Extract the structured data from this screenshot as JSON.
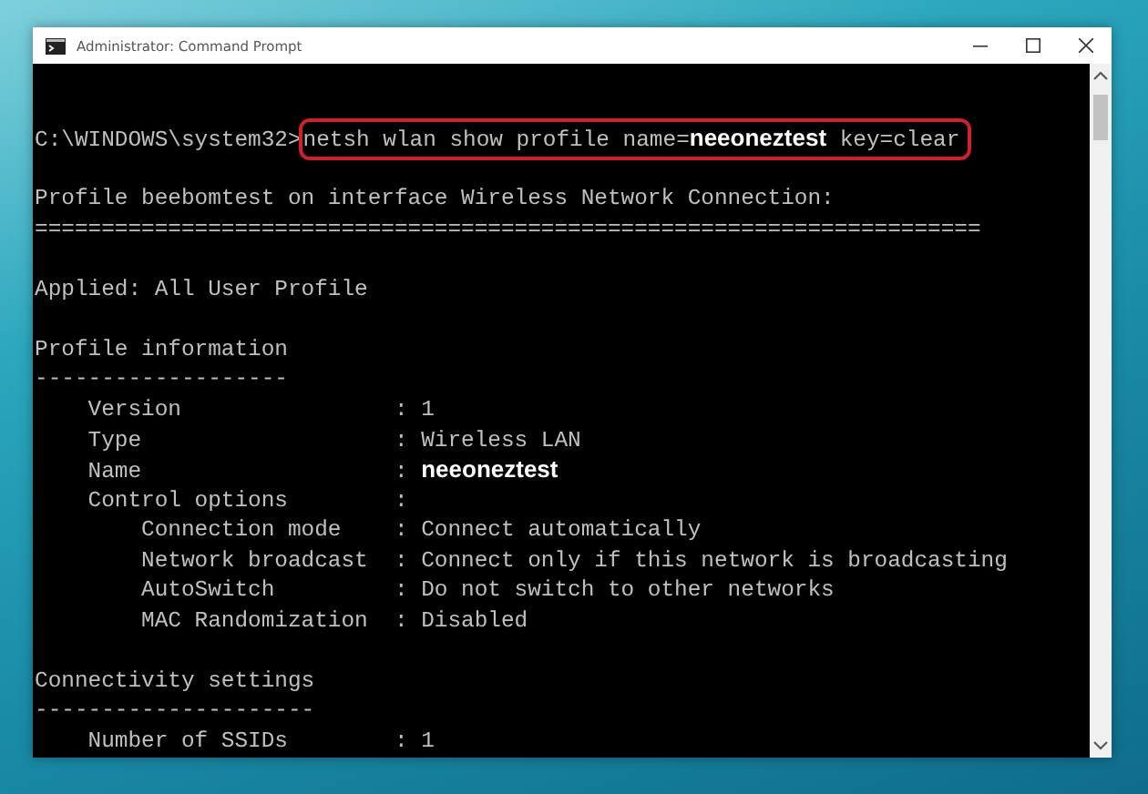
{
  "window": {
    "title": "Administrator: Command Prompt"
  },
  "console": {
    "lines": [
      {
        "kind": "blank"
      },
      {
        "kind": "blank"
      },
      {
        "kind": "command",
        "prompt": "C:\\WINDOWS\\system32>",
        "command": "netsh wlan show profile name=**neeoneztest** key=clear",
        "highlighted": true
      },
      {
        "kind": "blank"
      },
      {
        "kind": "text",
        "text": "Profile beebomtest on interface Wireless Network Connection:"
      },
      {
        "kind": "text",
        "text": "======================================================================="
      },
      {
        "kind": "blank"
      },
      {
        "kind": "text",
        "text": "Applied: All User Profile"
      },
      {
        "kind": "blank"
      },
      {
        "kind": "text",
        "text": "Profile information"
      },
      {
        "kind": "text",
        "text": "-------------------"
      },
      {
        "kind": "text",
        "text": "    Version                : 1"
      },
      {
        "kind": "text",
        "text": "    Type                   : Wireless LAN"
      },
      {
        "kind": "text",
        "text": "    Name                   : **neeoneztest**"
      },
      {
        "kind": "text",
        "text": "    Control options        :"
      },
      {
        "kind": "text",
        "text": "        Connection mode    : Connect automatically"
      },
      {
        "kind": "text",
        "text": "        Network broadcast  : Connect only if this network is broadcasting"
      },
      {
        "kind": "text",
        "text": "        AutoSwitch         : Do not switch to other networks"
      },
      {
        "kind": "text",
        "text": "        MAC Randomization  : Disabled"
      },
      {
        "kind": "blank"
      },
      {
        "kind": "text",
        "text": "Connectivity settings"
      },
      {
        "kind": "text",
        "text": "---------------------"
      },
      {
        "kind": "text",
        "text": "    Number of SSIDs        : 1"
      }
    ]
  }
}
